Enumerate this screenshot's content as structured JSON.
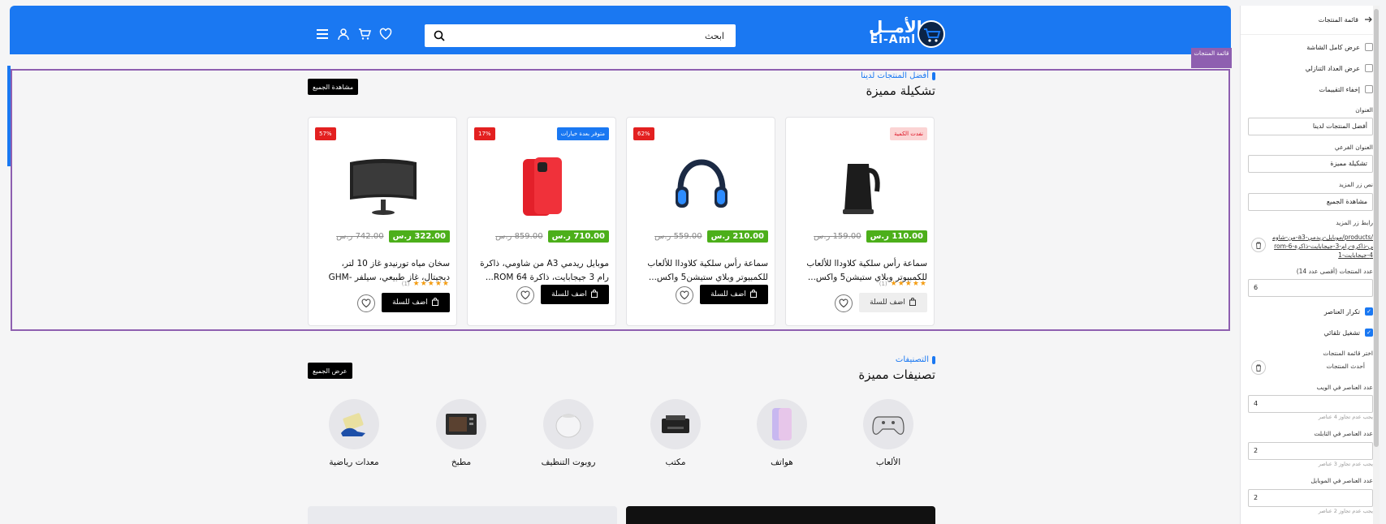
{
  "header": {
    "logo_ar": "الأمــل",
    "logo_en": "El-Aml",
    "search_placeholder": "ابحث"
  },
  "section_tag": "قائمة المنتجات",
  "products_section": {
    "kicker": "أفضل المنتجات لدينا",
    "title": "تشكيلة مميزة",
    "view_all": "مشاهدة الجميع",
    "products": [
      {
        "name": "سماعة رأس سلكية كلاوداا للألعاب للكمبيوتر وبلاي ستيشن5 واكس...",
        "price": "110.00 ر.س",
        "old_price": "159.00 ر.س",
        "badge": "نفدت الكمية",
        "rating": "★★★★★",
        "rating_count": "(1)",
        "add_label": "اضف للسلة"
      },
      {
        "name": "سماعة رأس سلكية كلاوداا للألعاب للكمبيوتر وبلاي ستيشن5 واكس...",
        "price": "210.00 ر.س",
        "old_price": "559.00 ر.س",
        "badge": "62%",
        "rating": "",
        "rating_count": "",
        "add_label": "اضف للسلة"
      },
      {
        "name": "موبايل ريدمي A3 من شاومي، ذاكرة رام 3 جيجابايت، ذاكرة ROM 64...",
        "price": "710.00 ر.س",
        "old_price": "859.00 ر.س",
        "badge": "17%",
        "badge2": "متوفر بعدة خيارات",
        "rating": "",
        "rating_count": "",
        "add_label": "اضف للسلة"
      },
      {
        "name": "سخان مياه تورنيدو غاز 10 لتر، ديجيتال، غاز طبيعي، سيلفر GHM-MP10N-S",
        "price": "322.00 ر.س",
        "old_price": "742.00 ر.س",
        "badge": "57%",
        "rating": "★★★★★",
        "rating_count": "(1)",
        "add_label": "اضف للسلة"
      }
    ]
  },
  "categories_section": {
    "kicker": "التصنيفات",
    "title": "تصنيفات مميزة",
    "view_all": "عرض الجميع",
    "items": [
      "الألعاب",
      "هواتف",
      "مكتب",
      "روبوت التنظيف",
      "مطبخ",
      "معدات رياضية"
    ]
  },
  "panel": {
    "title": "قائمة المنتجات",
    "full_width": "عرض كامل الشاشة",
    "countdown": "عرض العداد التنازلي",
    "hide_ratings": "إخفاء التقييمات",
    "title_label": "العنوان",
    "title_value": "أفضل المنتجات لدينا",
    "subtitle_label": "العنوان الفرعي",
    "subtitle_value": "تشكيلة مميزة",
    "more_text_label": "نص زر المزيد",
    "more_text_value": "مشاهدة الجميع",
    "more_link_label": "رابط زر المزيد",
    "more_link_value": "/products/موبايل-ريدمي-a3-من-شاومي-ذاكرة-رام-3-جيجابايت-ذاكرة-rom-64-جيجابايت-1",
    "count_label": "عدد المنتجات (أقصى عدد 14)",
    "count_value": "6",
    "repeat_label": "تكرار العناصر",
    "autoplay_label": "تشغيل تلقائي",
    "choose_list_label": "اختر قائمة المنتجات",
    "choose_list_value": "أحدث المنتجات",
    "web_label": "عدد العناصر في الويب",
    "web_value": "4",
    "web_hint": "يجب عدم تجاوز 4 عناصر",
    "tablet_label": "عدد العناصر في التابلت",
    "tablet_value": "2",
    "tablet_hint": "يجب عدم تجاوز 3 عناصر",
    "mobile_label": "عدد العناصر في الموبايل",
    "mobile_value": "2",
    "mobile_hint": "يجب عدم تجاوز 2 عناصر"
  }
}
